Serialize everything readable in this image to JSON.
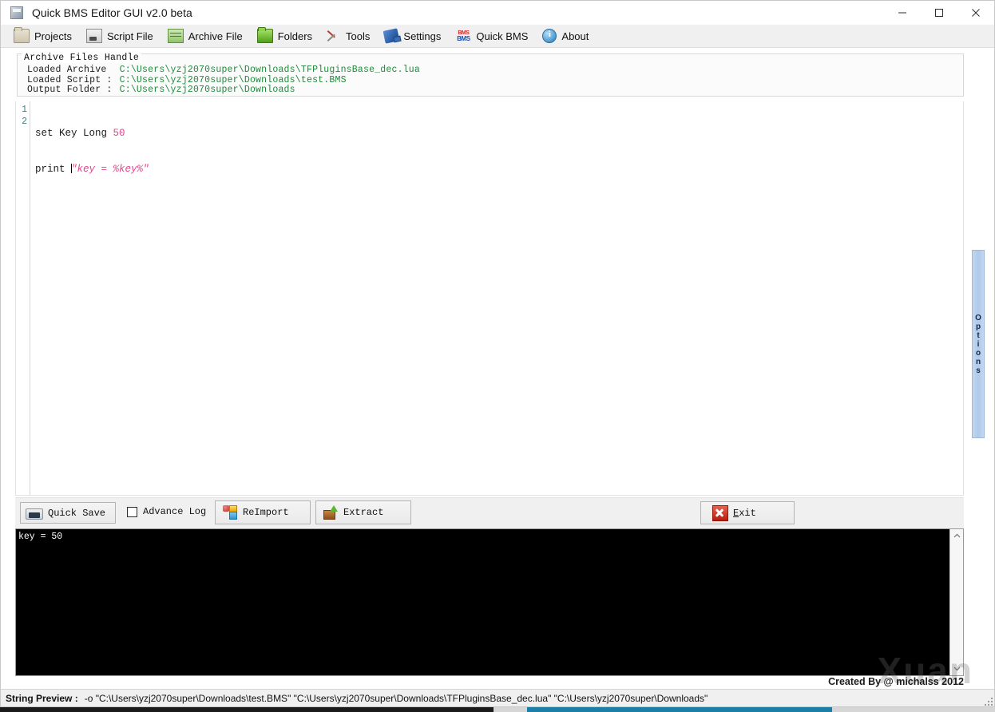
{
  "window": {
    "title": "Quick BMS Editor GUI v2.0 beta",
    "icon": "app-window-icon",
    "controls": {
      "minimize": "minimize-icon",
      "maximize": "maximize-icon",
      "close": "close-icon"
    }
  },
  "menu": {
    "items": [
      {
        "label": "Projects",
        "icon": "folder-icon"
      },
      {
        "label": "Script File",
        "icon": "script-file-icon"
      },
      {
        "label": "Archive File",
        "icon": "archive-file-icon"
      },
      {
        "label": "Folders",
        "icon": "folder-green-icon"
      },
      {
        "label": "Tools",
        "icon": "tools-icon"
      },
      {
        "label": "Settings",
        "icon": "settings-icon"
      },
      {
        "label": "Quick BMS",
        "icon": "bms-icon"
      },
      {
        "label": "About",
        "icon": "info-icon"
      }
    ]
  },
  "handle": {
    "legend": "Archive Files Handle",
    "rows": [
      {
        "label": "Loaded Archive  ",
        "value": "C:\\Users\\yzj2070super\\Downloads\\TFPluginsBase_dec.lua"
      },
      {
        "label": "Loaded Script : ",
        "value": "C:\\Users\\yzj2070super\\Downloads\\test.BMS"
      },
      {
        "label": "Output Folder : ",
        "value": "C:\\Users\\yzj2070super\\Downloads"
      }
    ],
    "value_color": "#1f8a3a"
  },
  "editor": {
    "lines": [
      {
        "number": "1",
        "tokens": [
          {
            "text": "set Key Long ",
            "type": "plain"
          },
          {
            "text": "50",
            "type": "num"
          }
        ]
      },
      {
        "number": "2",
        "tokens": [
          {
            "text": "print ",
            "type": "plain"
          },
          {
            "text": "\"key = %key%\"",
            "type": "str"
          }
        ]
      }
    ],
    "number_color": "#3f7f7f",
    "literal_color": "#e0468c"
  },
  "options_tab": {
    "label": "Options",
    "letters": [
      "O",
      "p",
      "t",
      "i",
      "o",
      "n",
      "s"
    ]
  },
  "actions": {
    "quick_save": {
      "label": "Quick Save",
      "icon": "save-icon"
    },
    "advance_log": {
      "label": "Advance Log",
      "checked": false
    },
    "reimport": {
      "label": "ReImport",
      "icon": "reimport-icon"
    },
    "extract": {
      "label": "Extract",
      "icon": "extract-icon"
    },
    "exit": {
      "label_accel": "E",
      "label_rest": "xit",
      "icon": "exit-icon"
    }
  },
  "console": {
    "text": "key = 50",
    "fg": "#ffffff",
    "bg": "#000000",
    "scroll_up_icon": "chevron-up-icon",
    "scroll_down_icon": "chevron-down-icon"
  },
  "credit": "Created By @ michalss 2012",
  "watermark": {
    "big": "Xuan",
    "url": "https://blog.csdn.net/gxne"
  },
  "status": {
    "label": "String Preview :",
    "value": "-o \"C:\\Users\\yzj2070super\\Downloads\\test.BMS\" \"C:\\Users\\yzj2070super\\Downloads\\TFPluginsBase_dec.lua\" \"C:\\Users\\yzj2070super\\Downloads\""
  }
}
